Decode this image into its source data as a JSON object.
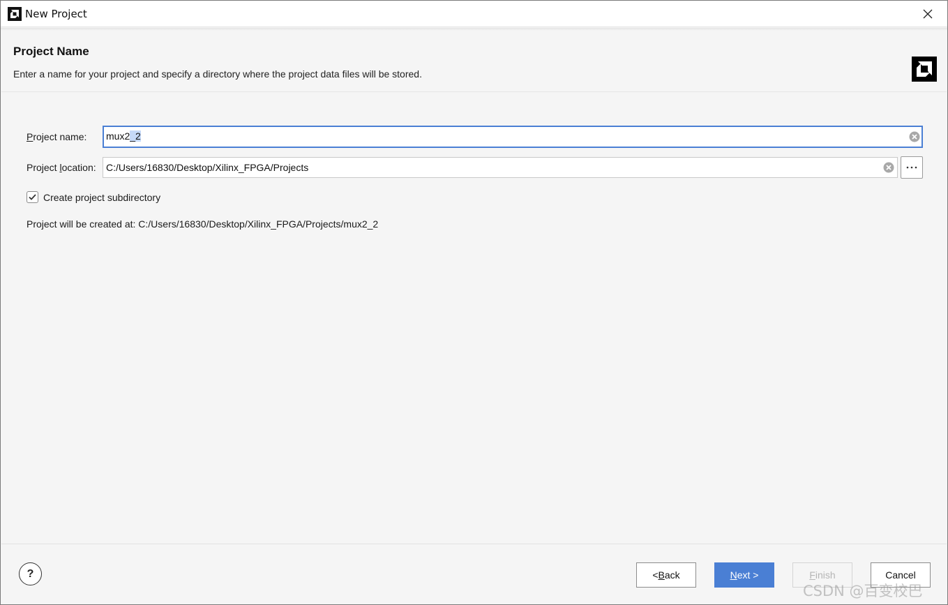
{
  "window": {
    "title": "New Project",
    "close_icon": "close-icon",
    "app_icon": "amd-logo-icon"
  },
  "header": {
    "title": "Project Name",
    "description": "Enter a name for your project and specify a directory where the project data files will be stored.",
    "logo_icon": "amd-logo-icon"
  },
  "form": {
    "project_name": {
      "label_accel": "P",
      "label_rest": "roject name:",
      "value_unselected": "mux2",
      "value_selected": "_2",
      "clear_icon": "clear-icon"
    },
    "project_location": {
      "label_pre": "Project ",
      "label_accel": "l",
      "label_rest": "ocation:",
      "value": "C:/Users/16830/Desktop/Xilinx_FPGA/Projects",
      "clear_icon": "clear-icon",
      "browse_icon": "ellipsis-icon"
    },
    "subdirectory": {
      "checked": true,
      "label": "Create project subdirectory"
    },
    "created_at": "Project will be created at: C:/Users/16830/Desktop/Xilinx_FPGA/Projects/mux2_2"
  },
  "footer": {
    "help_label": "?",
    "back": {
      "pre": "< ",
      "accel": "B",
      "rest": "ack"
    },
    "next": {
      "accel": "N",
      "rest": "ext >"
    },
    "finish": {
      "accel": "F",
      "rest": "inish"
    },
    "cancel": "Cancel"
  },
  "watermark": "CSDN @百变校巴",
  "colors": {
    "accent": "#4a7fd4",
    "selection": "#c6d9f7",
    "background": "#f5f5f5"
  }
}
